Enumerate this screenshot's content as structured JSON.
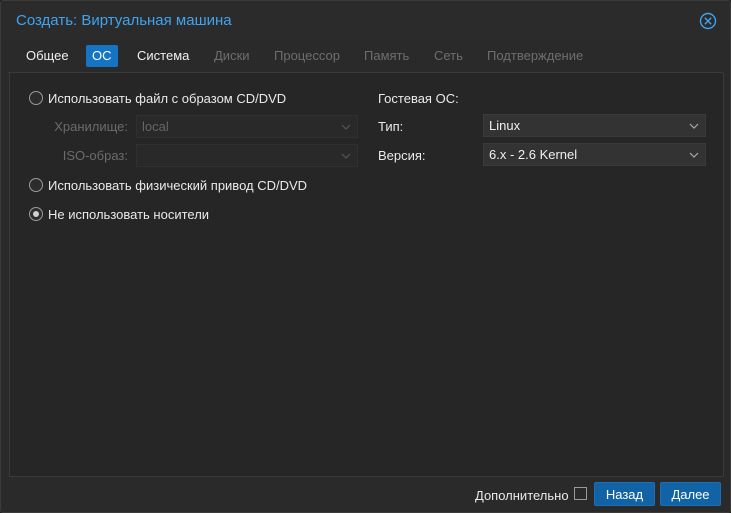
{
  "dialog": {
    "title": "Создать: Виртуальная машина"
  },
  "tabs": [
    {
      "label": "Общее",
      "state": "enabled"
    },
    {
      "label": "ОС",
      "state": "active"
    },
    {
      "label": "Система",
      "state": "enabled"
    },
    {
      "label": "Диски",
      "state": "disabled"
    },
    {
      "label": "Процессор",
      "state": "disabled"
    },
    {
      "label": "Память",
      "state": "disabled"
    },
    {
      "label": "Сеть",
      "state": "disabled"
    },
    {
      "label": "Подтверждение",
      "state": "disabled"
    }
  ],
  "media": {
    "use_image_label": "Использовать файл с образом CD/DVD",
    "storage_label": "Хранилище:",
    "storage_value": "local",
    "iso_label": "ISO-образ:",
    "iso_value": "",
    "physical_label": "Использовать физический привод CD/DVD",
    "no_media_label": "Не использовать носители",
    "selected": "no_media"
  },
  "guest_os": {
    "section_label": "Гостевая ОС:",
    "type_label": "Тип:",
    "type_value": "Linux",
    "version_label": "Версия:",
    "version_value": "6.x - 2.6 Kernel"
  },
  "footer": {
    "advanced_label": "Дополнительно",
    "advanced_checked": false,
    "back_label": "Назад",
    "next_label": "Далее"
  },
  "colors": {
    "accent": "#1574c4",
    "title": "#3fa4f0",
    "button": "#1262a6"
  }
}
